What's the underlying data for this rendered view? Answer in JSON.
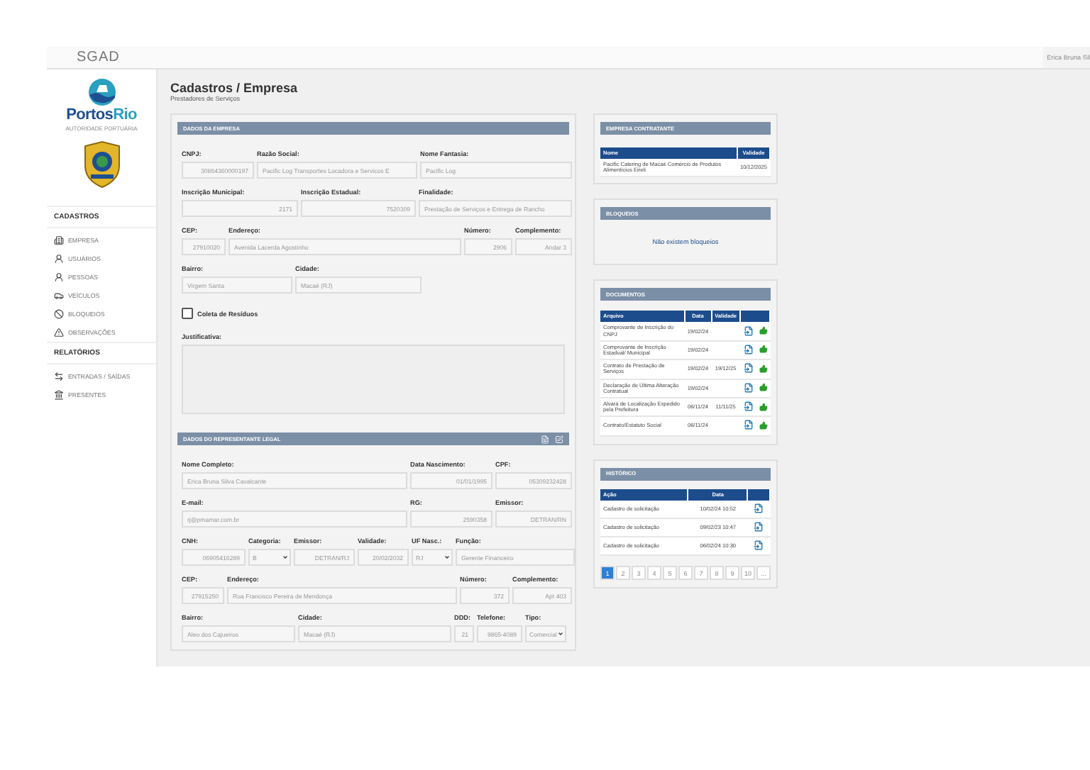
{
  "top_bar": {
    "app_name": "SGAD",
    "user": "Erica Bruna Sil"
  },
  "sidebar": {
    "logo": {
      "text": [
        "Portos",
        "Rio"
      ],
      "tagline": "AUTORIDADE PORTUÁRIA"
    },
    "sections": [
      {
        "title": "CADASTROS",
        "items": [
          {
            "label": "EMPRESA",
            "kind": "building"
          },
          {
            "label": "USUÁRIOS",
            "kind": "user"
          },
          {
            "label": "PESSOAS",
            "kind": "user"
          },
          {
            "label": "VEÍCULOS",
            "kind": "car"
          },
          {
            "label": "BLOQUEIOS",
            "kind": "ban"
          },
          {
            "label": "OBSERVAÇÕES",
            "kind": "alert"
          }
        ]
      },
      {
        "title": "RELATÓRIOS",
        "items": [
          {
            "label": "ENTRADAS / SAÍDAS",
            "kind": "swap"
          },
          {
            "label": "PRESENTES",
            "kind": "list"
          }
        ]
      }
    ]
  },
  "page": {
    "title": "Cadastros / Empresa",
    "subtitle": "Prestadores de Serviços"
  },
  "company": {
    "title": "DADOS DA EMPRESA",
    "rows": [
      [
        {
          "label": "CNPJ:",
          "value": "30864360000197",
          "kind": "text"
        },
        {
          "label": "Razão Social:",
          "value": "Pacific Log Transportes Locadora e Servicos E",
          "kind": "text"
        },
        {
          "label": "Nome Fantasia:",
          "value": "Pacific Log",
          "kind": "text"
        }
      ],
      [
        {
          "label": "Inscrição Municipal:",
          "value": "2171",
          "kind": "text"
        },
        {
          "label": "Inscrição Estadual:",
          "value": "7520309",
          "kind": "text"
        },
        {
          "label": "Finalidade:",
          "value": "Prestação de Serviços e Entrega de Rancho",
          "kind": "text"
        }
      ],
      [
        {
          "label": "CEP:",
          "value": "27910020",
          "kind": "text"
        },
        {
          "label": "Endereço:",
          "value": "Avenida Lacerda Agostinho",
          "kind": "text"
        },
        {
          "label": "Número:",
          "value": "2906",
          "kind": "text"
        },
        {
          "label": "Complemento:",
          "value": "Andar 3",
          "kind": "text"
        }
      ],
      [
        {
          "label": "Bairro:",
          "value": "Virgem Santa",
          "kind": "text"
        },
        {
          "label": "Cidade:",
          "value": "Macaé (RJ)",
          "kind": "text"
        }
      ]
    ],
    "checkbox": {
      "label": "Coleta de Resíduos",
      "checked": false
    },
    "justification_label": "Justificativa:"
  },
  "representative": {
    "title": "DADOS DO REPRESENTANTE LEGAL",
    "rows": [
      [
        {
          "label": "Nome Completo:",
          "value": "Erica Bruna Silva Cavalcante",
          "kind": "text"
        },
        {
          "label": "Data Nascimento:",
          "value": "01/01/1995",
          "kind": "text"
        },
        {
          "label": "CPF:",
          "value": "05309232428",
          "kind": "text"
        }
      ],
      [
        {
          "label": "E-mail:",
          "value": "rj@pmamar.com.br",
          "kind": "text"
        },
        {
          "label": "RG:",
          "value": "2590358",
          "kind": "text"
        },
        {
          "label": "Emissor:",
          "value": "DETRAN/RN",
          "kind": "text"
        }
      ],
      [
        {
          "label": "CNH:",
          "value": "06905416289",
          "kind": "text"
        },
        {
          "label": "Categoria:",
          "value": "B",
          "kind": "select"
        },
        {
          "label": "Emissor:",
          "value": "DETRAN/RJ",
          "kind": "text"
        },
        {
          "label": "Validade:",
          "value": "20/02/2032",
          "kind": "text"
        },
        {
          "label": "UF Nasc.:",
          "value": "RJ",
          "kind": "select"
        },
        {
          "label": "Função:",
          "value": "Gerente Financeiro",
          "kind": "text"
        }
      ],
      [
        {
          "label": "CEP:",
          "value": "27915250",
          "kind": "text"
        },
        {
          "label": "Endereço:",
          "value": "Rua Francisco Pereira de Mendonça",
          "kind": "text"
        },
        {
          "label": "Número:",
          "value": "372",
          "kind": "text"
        },
        {
          "label": "Complemento:",
          "value": "Apt 403",
          "kind": "text"
        }
      ],
      [
        {
          "label": "Bairro:",
          "value": "Aleo dos Cajueiros",
          "kind": "text"
        },
        {
          "label": "Cidade:",
          "value": "Macaé (RJ)",
          "kind": "text"
        },
        {
          "label": "DDD:",
          "value": "21",
          "kind": "text"
        },
        {
          "label": "Telefone:",
          "value": "9865-4089",
          "kind": "text"
        },
        {
          "label": "Tipo:",
          "value": "Comercial",
          "kind": "select"
        }
      ]
    ]
  },
  "contractor": {
    "title": "EMPRESA CONTRATANTE",
    "columns": [
      "Nome",
      "Validade"
    ],
    "rows": [
      [
        "Pacific Catering de Macaé Comércio de Produtos Alimentícios Eireli",
        "10/12/2025"
      ]
    ]
  },
  "blocks": {
    "title": "BLOQUEIOS",
    "message": "Não existem bloqueios"
  },
  "documents": {
    "title": "DOCUMENTOS",
    "columns": [
      "Arquivo",
      "Data",
      "Validade"
    ],
    "rows": [
      [
        "Comprovante de Inscrição do CNPJ",
        "19/02/24"
      ],
      [
        "Comprovante de Inscrição Estadual/ Municipal",
        "19/02/24"
      ],
      [
        "Contrato de Prestação de Serviços",
        "19/02/24",
        "19/12/25"
      ],
      [
        "Declaração de Última Alteração Contratual",
        "19/02/24"
      ],
      [
        "Alvará de Localização Expedido pela Prefeitura",
        "06/11/24",
        "11/11/25"
      ],
      [
        "Contrato/Estatuto Social",
        "06/11/24"
      ]
    ]
  },
  "history": {
    "title": "HISTÓRICO",
    "columns": [
      "Ação",
      "Data"
    ],
    "rows": [
      [
        "Cadastro de solicitação",
        "10/02/24 10:52"
      ],
      [
        "Cadastro de solicitação",
        "09/02/23 10:47"
      ],
      [
        "Cadastro de solicitação",
        "06/02/24 10:30"
      ]
    ],
    "pages": [
      {
        "label": "1",
        "selected": true
      },
      {
        "label": "2",
        "selected": false
      },
      {
        "label": "3",
        "selected": false
      },
      {
        "label": "4",
        "selected": false
      },
      {
        "label": "5",
        "selected": false
      },
      {
        "label": "6",
        "selected": false
      },
      {
        "label": "7",
        "selected": false
      },
      {
        "label": "8",
        "selected": false
      },
      {
        "label": "9",
        "selected": false
      },
      {
        "label": "10",
        "selected": false
      },
      {
        "label": "...",
        "selected": false
      }
    ]
  }
}
